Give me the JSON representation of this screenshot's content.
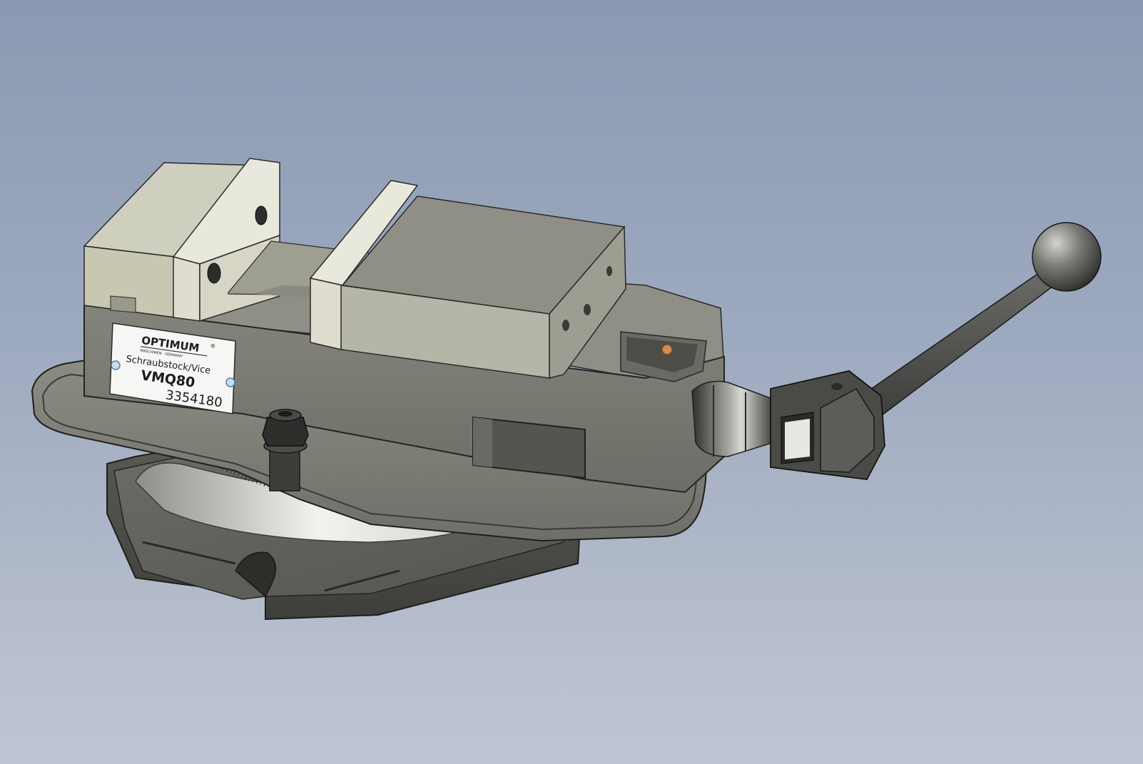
{
  "nameplate": {
    "brand": "OPTIMUM",
    "registered_mark": "®",
    "tagline": "MASCHINEN · GERMANY",
    "description": "Schraubstock/Vice",
    "model": "VMQ80",
    "article_number": "3354180"
  },
  "colors": {
    "background_top": "#8a9ab2",
    "background_bottom": "#bfc5d2",
    "jaw_light": "#e6e5d9",
    "jaw_mid": "#c6c6b4",
    "body_top": "#8d8d82",
    "body_front": "#767670",
    "base_dark": "#4a4a47",
    "scale_face": "#e8e8e2"
  }
}
